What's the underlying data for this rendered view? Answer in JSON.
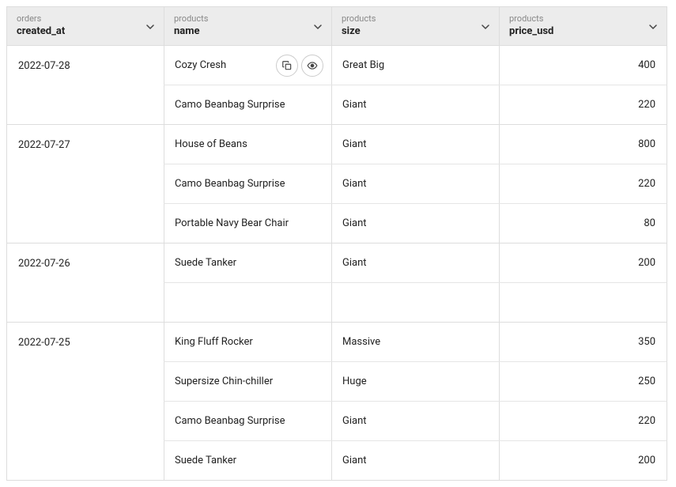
{
  "columns": [
    {
      "table": "orders",
      "name": "created_at"
    },
    {
      "table": "products",
      "name": "name"
    },
    {
      "table": "products",
      "name": "size"
    },
    {
      "table": "products",
      "name": "price_usd"
    }
  ],
  "groups": [
    {
      "created_at": "2022-07-28",
      "rows": [
        {
          "name": "Cozy Cresh",
          "size": "Great Big",
          "price_usd": "400",
          "hover": true
        },
        {
          "name": "Camo Beanbag Surprise",
          "size": "Giant",
          "price_usd": "220"
        }
      ]
    },
    {
      "created_at": "2022-07-27",
      "rows": [
        {
          "name": "House of Beans",
          "size": "Giant",
          "price_usd": "800"
        },
        {
          "name": "Camo Beanbag Surprise",
          "size": "Giant",
          "price_usd": "220"
        },
        {
          "name": "Portable Navy Bear Chair",
          "size": "Giant",
          "price_usd": "80"
        }
      ]
    },
    {
      "created_at": "2022-07-26",
      "spacer": true,
      "rows": [
        {
          "name": "Suede Tanker",
          "size": "Giant",
          "price_usd": "200"
        }
      ]
    },
    {
      "created_at": "2022-07-25",
      "rows": [
        {
          "name": "King Fluff Rocker",
          "size": "Massive",
          "price_usd": "350"
        },
        {
          "name": "Supersize Chin-chiller",
          "size": "Huge",
          "price_usd": "250"
        },
        {
          "name": "Camo Beanbag Surprise",
          "size": "Giant",
          "price_usd": "220"
        },
        {
          "name": "Suede Tanker",
          "size": "Giant",
          "price_usd": "200"
        }
      ]
    }
  ]
}
